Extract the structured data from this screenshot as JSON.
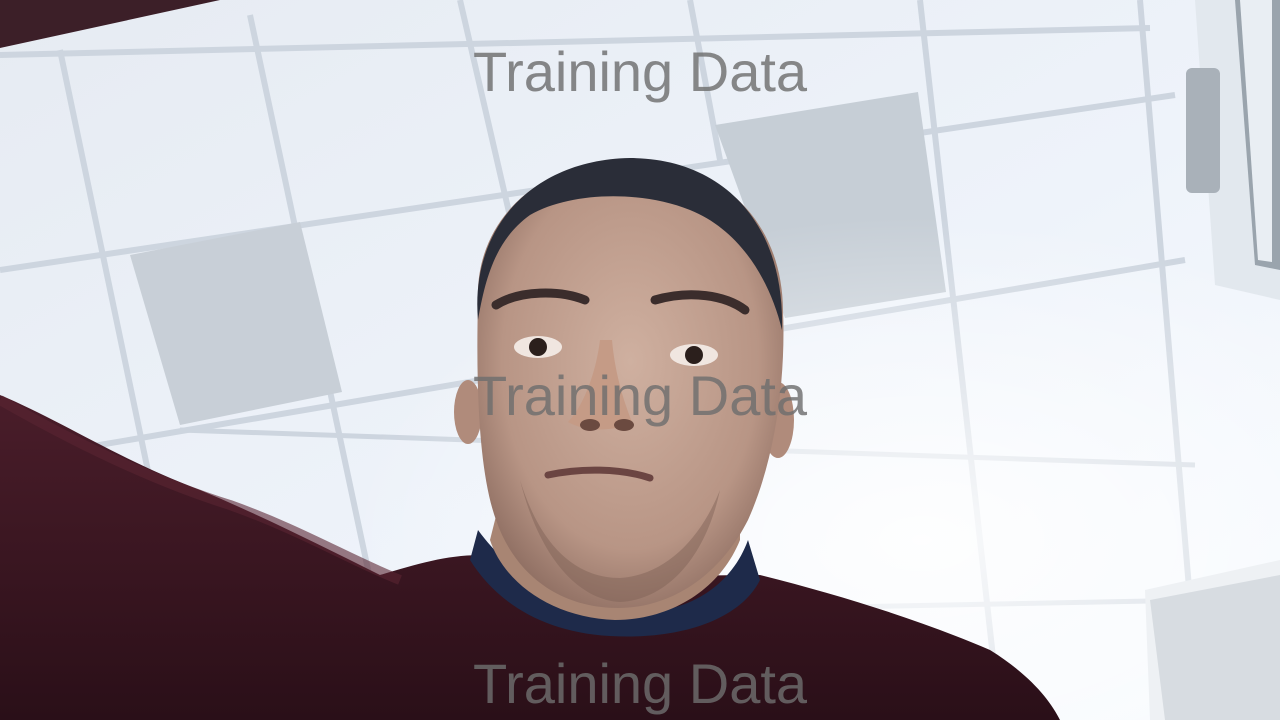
{
  "watermark": {
    "text": "Training Data",
    "color": "#6e6e6e"
  },
  "palette": {
    "ceiling_tile": "#e9eef5",
    "ceiling_tile_bright": "#f7faff",
    "shaded_tile": "#c9d0d8",
    "grid_line": "#cfd7e0",
    "skin": "#c8a796",
    "skin_shadow": "#8f6f62",
    "hair": "#2a2d38",
    "sweater": "#3a1722",
    "sweater_highlight": "#5a2432",
    "collar": "#1e2a4a",
    "window_frame": "#d9dfe6"
  }
}
